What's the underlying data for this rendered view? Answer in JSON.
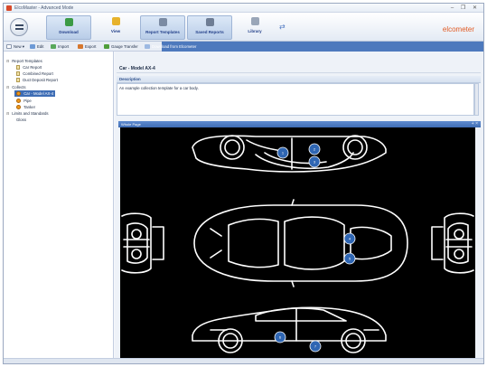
{
  "window": {
    "title": "ElcoMaster - Advanced Mode",
    "controls": "– ❐ ✕"
  },
  "ribbon": {
    "tabs": [
      {
        "label": "Download",
        "icon": "download-icon",
        "color": "#3b9a45"
      },
      {
        "label": "View",
        "icon": "view-icon",
        "color": "#e7b22b"
      },
      {
        "label": "Report Templates",
        "icon": "report-templates-icon",
        "color": "#7b8ba3"
      },
      {
        "label": "Saved Reports",
        "icon": "saved-reports-icon",
        "color": "#6e7d94"
      },
      {
        "label": "Library",
        "icon": "library-icon",
        "color": "#9aa6b8"
      }
    ],
    "brand": "elcometer",
    "brand_color": "#e15a23"
  },
  "toolbar": {
    "new_label": "New ▾",
    "edit_label": "Edit",
    "import_label": "Import",
    "export_label": "Export",
    "gauge_transfer_label": "Gauge Transfer",
    "download_from_elcometer_label": "Download from Elcometer"
  },
  "sidebar": {
    "report_templates": "Report Templates",
    "car_report": "Car Report",
    "combined_report": "Combined Report",
    "duct_deposit_report": "Duct Deposit Report",
    "collects": "Collects",
    "car_model": "Car - Model AX-4",
    "pipe": "Pipe",
    "tanker": "Tanker",
    "limits_and_standards": "Limits and Standards",
    "gloss": "Gloss"
  },
  "main": {
    "heading": "Car - Model AX-4",
    "description_label": "Description",
    "description_text": "An example collection template for a car body.",
    "page_title": "Whole Page",
    "page_controls": "+ ×"
  },
  "markers": [
    {
      "id": "marker-1",
      "label": "1",
      "view": "top-left-side"
    },
    {
      "id": "marker-2",
      "label": "2",
      "view": "top-left-side"
    },
    {
      "id": "marker-3",
      "label": "3",
      "view": "top-left-side"
    },
    {
      "id": "marker-4",
      "label": "4",
      "view": "roof"
    },
    {
      "id": "marker-5",
      "label": "5",
      "view": "roof"
    },
    {
      "id": "marker-6",
      "label": "6",
      "view": "bottom-right-side"
    },
    {
      "id": "marker-7",
      "label": "7",
      "view": "bottom-right-side"
    }
  ],
  "colors": {
    "accent": "#3e6db5",
    "marker_fill": "#2f66b3",
    "canvas_bg": "#000000"
  }
}
